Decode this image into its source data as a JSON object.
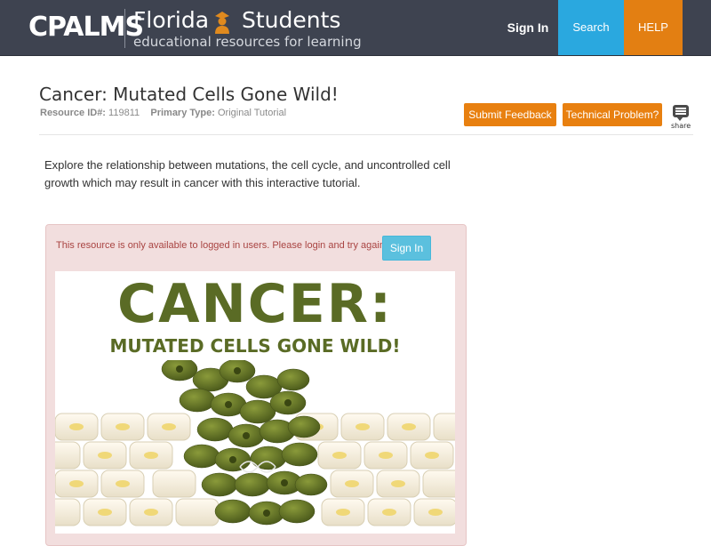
{
  "header": {
    "logo_text": "CPALMS",
    "brand_title_left": "Florida",
    "brand_title_right": "Students",
    "brand_subtitle": "educational resources for learning",
    "nav": {
      "signin": "Sign In",
      "search": "Search",
      "help": "HELP"
    },
    "colors": {
      "search": "#2aa8df",
      "help": "#e37f12",
      "bar": "#3e4350"
    }
  },
  "resource": {
    "title": "Cancer: Mutated Cells Gone Wild!",
    "id_label": "Resource ID#:",
    "id_value": "119811",
    "type_label": "Primary Type:",
    "type_value": "Original Tutorial",
    "submit_feedback": "Submit Feedback",
    "technical_problem": "Technical Problem?",
    "share_label": "share",
    "description": "Explore the relationship between mutations, the cell cycle, and uncontrolled cell growth which may result in cancer with this interactive tutorial."
  },
  "alert": {
    "message": "This resource is only available to logged in users. Please login and try again.",
    "signin_button": "Sign In"
  },
  "banner": {
    "title": "CANCER:",
    "subtitle": "MUTATED CELLS GONE WILD!"
  }
}
